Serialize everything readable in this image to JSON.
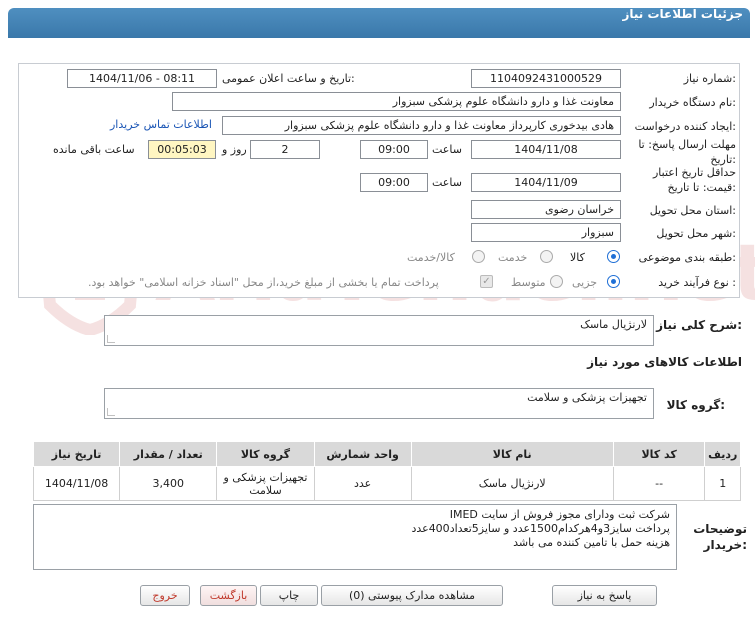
{
  "header": {
    "title": "جزئیات اطلاعات نیاز"
  },
  "form": {
    "need_number": {
      "label": "شماره نیاز:",
      "value": "1104092431000529"
    },
    "announce_datetime": {
      "label": "تاریخ و ساعت اعلان عمومی:",
      "value": "1404/11/06 - 08:11"
    },
    "buyer_org": {
      "label": "نام دستگاه خریدار:",
      "value": "معاونت غذا و دارو   دانشگاه علوم پزشکی سبزوار"
    },
    "requester": {
      "label": "ایجاد کننده درخواست:",
      "value": "هادی بیدخوری کارپرداز معاونت غذا و دارو   دانشگاه علوم پزشکی سبزوار",
      "contact_link": "اطلاعات تماس خریدار"
    },
    "reply_deadline": {
      "label_line1": "مهلت ارسال پاسخ: تا",
      "label_line2": "تاریخ:",
      "date": "1404/11/08",
      "time_label": "ساعت",
      "time": "09:00",
      "days": "2",
      "days_label": "روز و",
      "remaining": "00:05:03",
      "remaining_label": "ساعت باقی مانده"
    },
    "price_validity": {
      "label_line1": "حداقل تاریخ اعتبار",
      "label_line2": "قیمت: تا تاریخ:",
      "date": "1404/11/09",
      "time_label": "ساعت",
      "time": "09:00"
    },
    "province": {
      "label": "استان محل تحویل:",
      "value": "خراسان رضوی"
    },
    "city": {
      "label": "شهر محل تحویل:",
      "value": "سبزوار"
    },
    "category": {
      "label": "طبقه بندی موضوعی:",
      "options": [
        "کالا",
        "خدمت",
        "کالا/خدمت"
      ],
      "selected": "کالا"
    },
    "process_type": {
      "label": "نوع فرآیند خرید :",
      "options": [
        "جزیی",
        "متوسط"
      ],
      "selected": "جزیی",
      "payment_note": "پرداخت تمام یا بخشی از مبلغ خرید،از محل \"اسناد خزانه اسلامی\" خواهد بود."
    }
  },
  "description": {
    "label": "شرح کلی نیاز:",
    "value": "لارنژیال ماسک"
  },
  "goods_info": {
    "title": "اطلاعات کالاهای مورد نیاز"
  },
  "goods_group": {
    "label": "گروه کالا:",
    "value": "تجهیزات پزشکی و سلامت"
  },
  "table": {
    "headers": [
      "ردیف",
      "کد کالا",
      "نام کالا",
      "واحد شمارش",
      "گروه کالا",
      "تعداد / مقدار",
      "تاریخ نیاز"
    ],
    "rows": [
      [
        "1",
        "--",
        "لارنژیال ماسک",
        "عدد",
        "تجهیزات پزشکی و سلامت",
        "3,400",
        "1404/11/08"
      ]
    ]
  },
  "buyer_notes": {
    "label_line1": "توضیحات",
    "label_line2": "خریدار:",
    "lines": [
      "شرکت ثبت ودارای مجوز فروش از سایت IMED",
      "پرداخت سایز3و4هرکدام1500عدد و سایز5تعداد400عدد",
      "هزینه حمل با تامین کننده می باشد"
    ]
  },
  "buttons": {
    "reply": "پاسخ به نیاز",
    "attachments": "مشاهده مدارک پیوستی (0)",
    "print": "چاپ",
    "back": "بازگشت",
    "exit": "خروج"
  },
  "watermark": "AriaTender.net",
  "colors": {
    "header": "#3a78aa",
    "link": "#1a55b5",
    "remaining_bg": "#fff6c2",
    "exit_text": "#c0392b"
  }
}
